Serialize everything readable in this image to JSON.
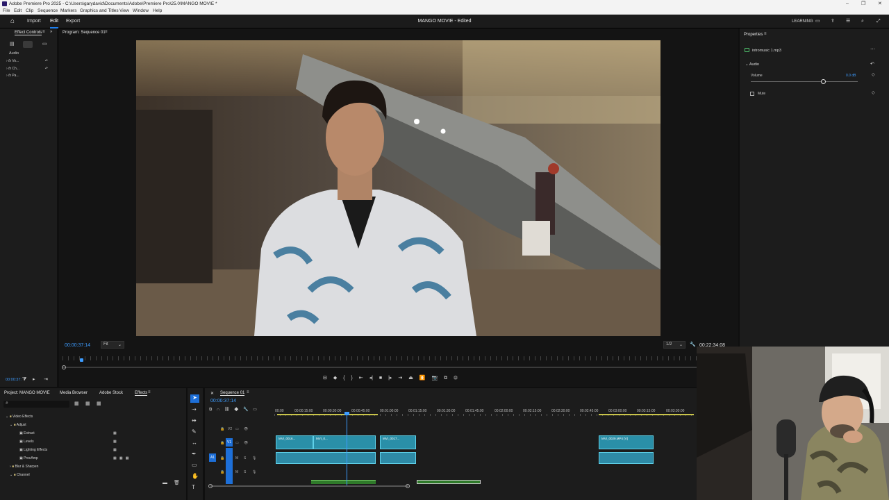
{
  "window": {
    "title": "Adobe Premiere Pro 2025 - C:\\Users\\garydavid\\Documents\\Adobe\\Premiere Pro\\25.0\\MANGO MOVIE *",
    "controls": [
      "–",
      "❐",
      "✕"
    ]
  },
  "menu": [
    "File",
    "Edit",
    "Clip",
    "Sequence",
    "Markers",
    "Graphics and Titles",
    "View",
    "Window",
    "Help"
  ],
  "header": {
    "tabs": [
      "Import",
      "Edit",
      "Export"
    ],
    "active_tab": "Edit",
    "project_title": "MANGO MOVIE - Edited",
    "workspace_label": "LEARNING"
  },
  "effect_controls": {
    "tab": "Effect Controls",
    "section": "Audio",
    "rows": [
      "Vo...",
      "Ch...",
      "Pa..."
    ],
    "row_prefix": "fx",
    "timecode": "00:00:37:"
  },
  "program": {
    "tab": "Program: Sequence 01",
    "timecode": "00:00:37:14",
    "fit": "Fit",
    "resolution": "1/2",
    "duration": "00:22:34:08"
  },
  "properties": {
    "tab": "Properties",
    "file": "intromusic 1.mp3",
    "section": "Audio",
    "volume_label": "Volume",
    "volume_value": "0.0 dB",
    "volume_level": 0.68,
    "mute_label": "Mute"
  },
  "project": {
    "tabs": [
      "Project: MANGO MOVIE",
      "Media Browser",
      "Adobe Stock",
      "Effects"
    ],
    "active_tab": "Effects",
    "tree": [
      {
        "label": "Video Effects",
        "level": 0
      },
      {
        "label": "Adjust",
        "level": 1
      },
      {
        "label": "Extract",
        "level": 2
      },
      {
        "label": "Levels",
        "level": 2
      },
      {
        "label": "Lighting Effects",
        "level": 2
      },
      {
        "label": "ProcAmp",
        "level": 2
      },
      {
        "label": "Blur & Sharpen",
        "level": 1
      },
      {
        "label": "Channel",
        "level": 1
      }
    ]
  },
  "timeline": {
    "tab": "Sequence 01",
    "timecode": "00:00:37:14",
    "ticks": [
      "00:00",
      "00:00:15:00",
      "00:00:30:00",
      "00:00:45:00",
      "00:01:00:00",
      "00:01:15:00",
      "00:01:30:00",
      "00:01:45:00",
      "00:02:00:00",
      "00:02:15:00",
      "00:02:30:00",
      "00:02:45:00",
      "00:03:00:00",
      "00:03:15:00",
      "00:03:30:00"
    ],
    "tracks": {
      "v2": "V2",
      "v1": "V1",
      "a1": "A1",
      "a2": "A2",
      "m": "M",
      "s": "S"
    },
    "clips": {
      "c1": "MVI_0016...",
      "c2": "MVI_0...",
      "c3": "MVI_0017...",
      "c4": "MVI_0029.MP4 [V]"
    }
  }
}
